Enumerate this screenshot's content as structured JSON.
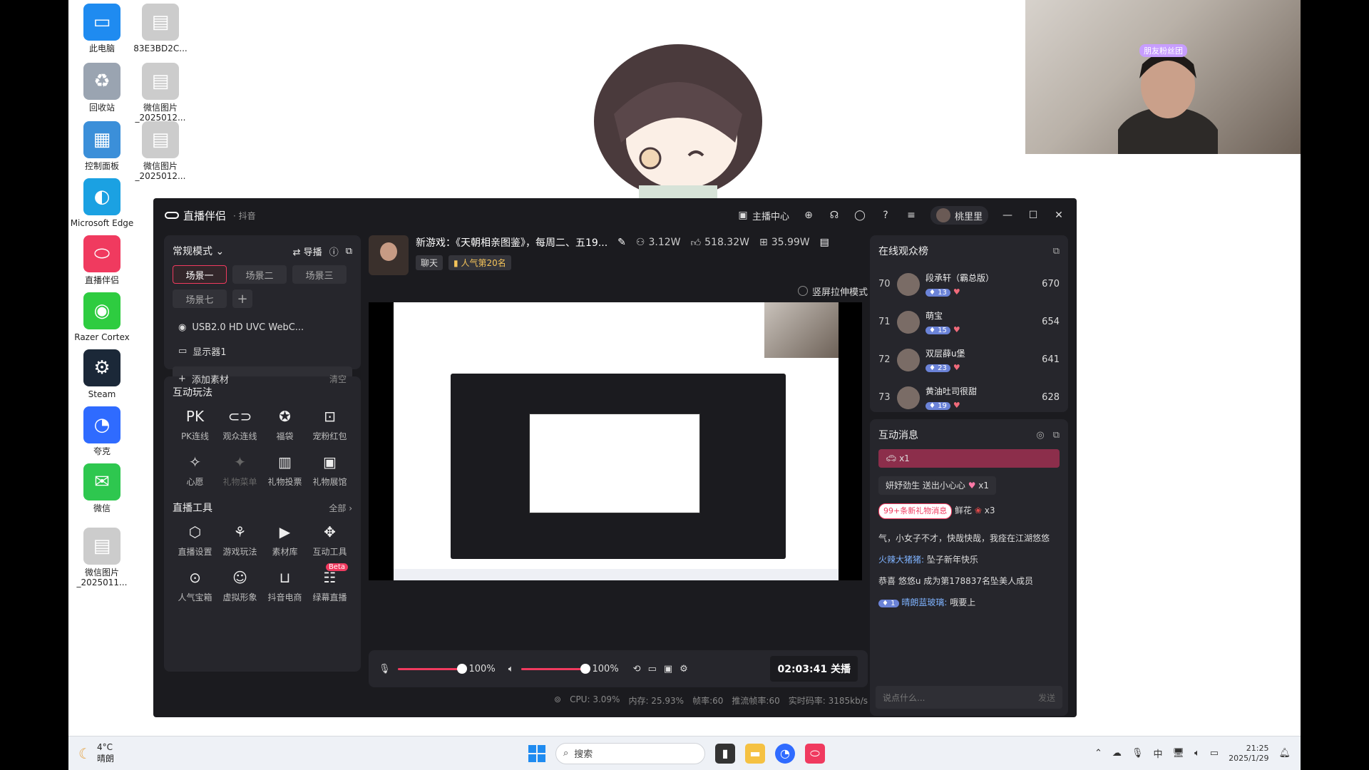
{
  "desktop": {
    "icons": [
      {
        "label": "此电脑",
        "icon": "monitor-icon",
        "color": "#1f8bf0"
      },
      {
        "label": "83E3BD2C...",
        "icon": "image-file-icon",
        "color": "#cccccc"
      },
      {
        "label": "回收站",
        "icon": "recycle-bin-icon",
        "color": "#9aa4b1"
      },
      {
        "label": "微信图片_2025012...",
        "icon": "image-file-icon",
        "color": "#cccccc"
      },
      {
        "label": "控制面板",
        "icon": "control-panel-icon",
        "color": "#3b8fd9"
      },
      {
        "label": "微信图片_2025012...",
        "icon": "image-file-icon",
        "color": "#cccccc"
      },
      {
        "label": "Microsoft Edge",
        "icon": "edge-icon",
        "color": "#1ba1e2"
      },
      {
        "label": "直播伴侣",
        "icon": "live-companion-icon",
        "color": "#f03a5f"
      },
      {
        "label": "Razer Cortex",
        "icon": "razer-icon",
        "color": "#2ecc40"
      },
      {
        "label": "Steam",
        "icon": "steam-icon",
        "color": "#1b2838"
      },
      {
        "label": "夸克",
        "icon": "quark-icon",
        "color": "#2f6bff"
      },
      {
        "label": "微信",
        "icon": "wechat-icon",
        "color": "#2ec74f"
      },
      {
        "label": "微信图片_2025011...",
        "icon": "image-file-icon",
        "color": "#cccccc"
      }
    ],
    "webcam_tag": "朋友粉丝团"
  },
  "app": {
    "title": "直播伴侣",
    "platform": "· 抖音",
    "toolbar": {
      "anchor_center": "主播中心",
      "username": "桃里里"
    },
    "left": {
      "mode": "常规模式",
      "guide": "导播",
      "scenes": [
        "场景一",
        "场景二",
        "场景三",
        "场景七"
      ],
      "sources": [
        {
          "label": "USB2.0 HD UVC WebC..."
        },
        {
          "label": "显示器1"
        }
      ],
      "add_source": "添加素材",
      "clear": "清空",
      "interactive_title": "互动玩法",
      "interactive": [
        {
          "name": "PK连线",
          "icon": "pk-icon"
        },
        {
          "name": "观众连线",
          "icon": "audience-link-icon"
        },
        {
          "name": "福袋",
          "icon": "lucky-bag-icon"
        },
        {
          "name": "宠粉红包",
          "icon": "red-packet-icon"
        },
        {
          "name": "心愿",
          "icon": "wish-icon"
        },
        {
          "name": "礼物菜单",
          "icon": "gift-menu-icon",
          "dim": true
        },
        {
          "name": "礼物投票",
          "icon": "gift-vote-icon"
        },
        {
          "name": "礼物展馆",
          "icon": "gift-hall-icon"
        }
      ],
      "tools_title": "直播工具",
      "tools_all": "全部 ›",
      "tools": [
        {
          "name": "直播设置",
          "icon": "settings-icon"
        },
        {
          "name": "游戏玩法",
          "icon": "game-play-icon"
        },
        {
          "name": "素材库",
          "icon": "material-library-icon"
        },
        {
          "name": "互动工具",
          "icon": "interactive-tool-icon"
        },
        {
          "name": "人气宝箱",
          "icon": "treasure-box-icon"
        },
        {
          "name": "虚拟形象",
          "icon": "avatar-icon"
        },
        {
          "name": "抖音电商",
          "icon": "ecommerce-icon"
        },
        {
          "name": "绿幕直播",
          "icon": "green-screen-icon",
          "badge": "Beta"
        }
      ]
    },
    "center": {
      "stream_title": "新游戏：《天朝相亲图鉴》，每周二、五19...",
      "viewers": "3.12W",
      "likes": "518.32W",
      "gifts": "35.99W",
      "tag_chat": "聊天",
      "tag_rank": "人气第20名",
      "portrait_mode": "竖屏拉伸模式",
      "mic_volume": "100%",
      "speaker_volume": "100%",
      "mic_level": 1.0,
      "speaker_level": 1.0,
      "timer_button": "02:03:41 关播",
      "status": {
        "cpu": "CPU: 3.09%",
        "mem": "内存: 25.93%",
        "fps": "帧率:60",
        "push_fps": "推流帧率:60",
        "bitrate": "实时码率: 3185kb/s"
      }
    },
    "right": {
      "rank_title": "在线观众榜",
      "rank": [
        {
          "num": "70",
          "name": "段承轩（霸总版）",
          "level": "13",
          "score": "670"
        },
        {
          "num": "71",
          "name": "萌宝",
          "level": "15",
          "score": "654"
        },
        {
          "num": "72",
          "name": "双层薛u堡",
          "level": "23",
          "score": "641"
        },
        {
          "num": "73",
          "name": "黄油吐司很甜",
          "level": "19",
          "score": "628"
        }
      ],
      "msg_title": "互动消息",
      "gift1_count": "x1",
      "gift2_user": "妍妤劲生",
      "gift2_text": "送出小心心",
      "gift2_count": "x1",
      "new_gift_badge": "99+条新礼物消息",
      "gift3_suffix": "鲜花",
      "gift3_count": "x3",
      "msg_text": "气，小女子不才，快哉快哉，我痊在江湖悠悠",
      "msg4_user": "火辣大猪猪:",
      "msg4_text": "坠子新年快乐",
      "msg5_text": "恭喜 悠悠u 成为第178837名坠美人成员",
      "msg6_level": "1",
      "msg6_user": "晴朗蓝玻璃:",
      "msg6_text": "哦要上",
      "input_placeholder": "说点什么...",
      "send": "发送"
    }
  },
  "taskbar": {
    "temp": "4°C",
    "weather": "晴朗",
    "search": "搜索",
    "ime": "中",
    "time": "21:25",
    "date": "2025/1/29"
  }
}
